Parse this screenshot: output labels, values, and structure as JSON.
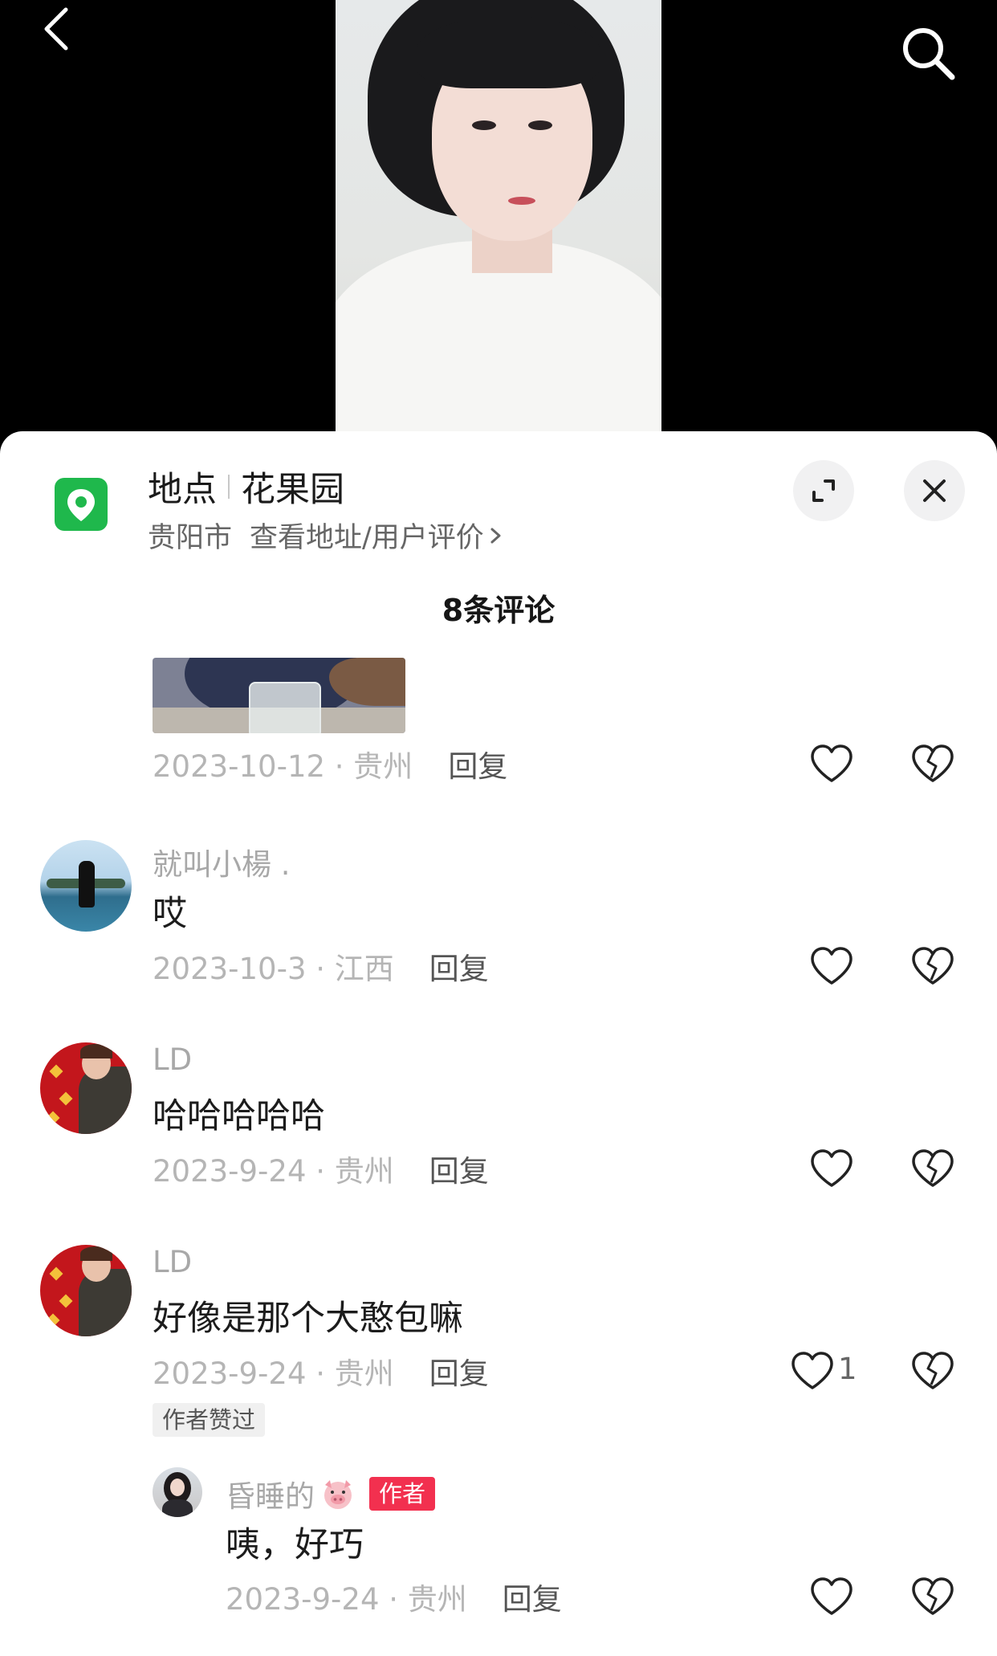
{
  "video": {
    "back_icon": "chevron-left-icon",
    "search_icon": "search-icon"
  },
  "location": {
    "label": "地点",
    "name": "花果园",
    "city": "贵阳市",
    "link_text": "查看地址/用户评价",
    "icon": "map-pin-icon",
    "icon_color": "#1fb84c"
  },
  "header": {
    "comment_count_text": "8条评论"
  },
  "comments": [
    {
      "has_image": true,
      "date_loc": "2023-10-12 · 贵州",
      "reply": "回复"
    },
    {
      "username": "就叫小楊 .",
      "text": "哎",
      "date_loc": "2023-10-3 · 江西",
      "reply": "回复"
    },
    {
      "username": "LD",
      "text": "哈哈哈哈哈",
      "date_loc": "2023-9-24 · 贵州",
      "reply": "回复"
    },
    {
      "username": "LD",
      "text": "好像是那个大憨包嘛",
      "date_loc": "2023-9-24 · 贵州",
      "reply": "回复",
      "likes": "1",
      "author_liked": "作者赞过"
    }
  ],
  "reply": {
    "username": "昏睡的",
    "author_badge": "作者",
    "text": "咦，好巧",
    "date_loc": "2023-9-24 · 贵州",
    "reply": "回复"
  },
  "colors": {
    "author_badge": "#f2304f",
    "meta_gray": "#b5b5b5"
  }
}
